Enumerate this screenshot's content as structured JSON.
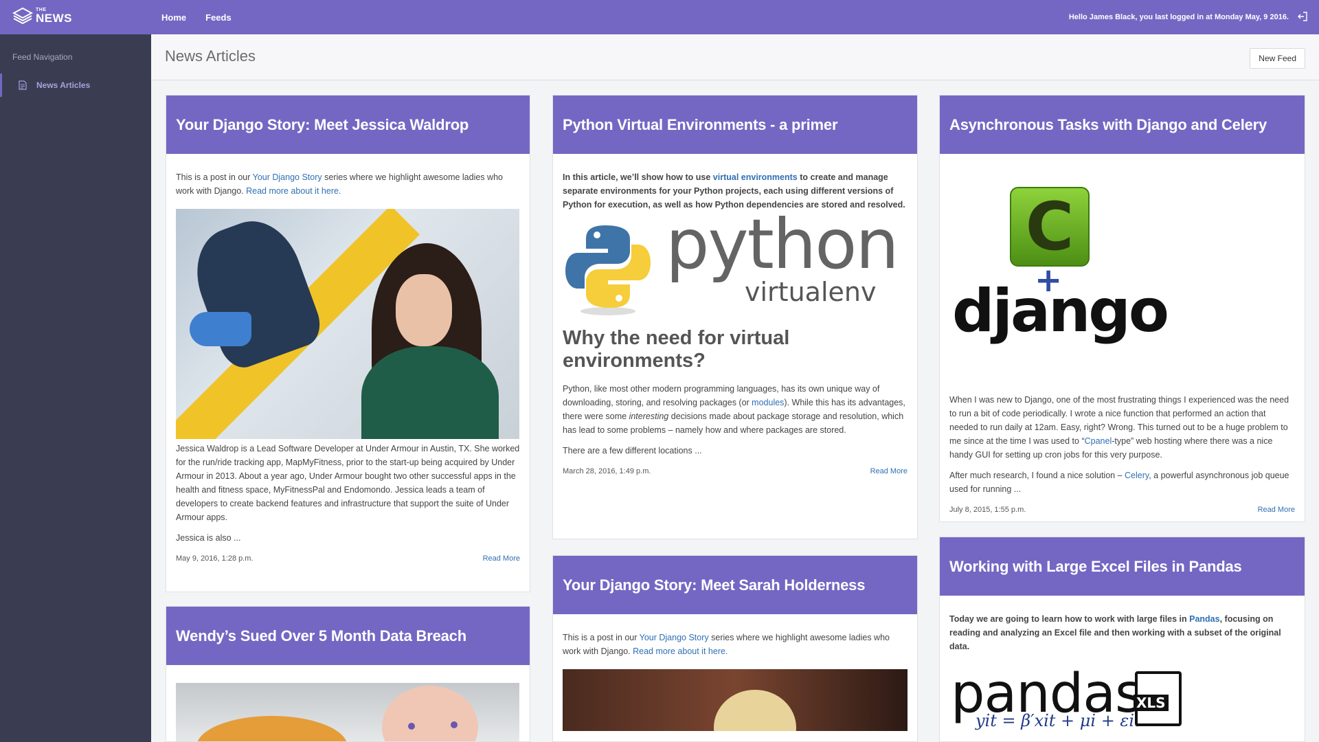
{
  "app": {
    "logo_the": "THE",
    "logo_news": "NEWS",
    "nav": [
      "Home",
      "Feeds"
    ],
    "greeting": "Hello James Black, you last logged in at Monday May, 9 2016."
  },
  "sidebar": {
    "heading": "Feed Navigation",
    "items": [
      {
        "label": "News Articles",
        "icon": "file-icon"
      }
    ]
  },
  "page": {
    "title": "News Articles",
    "new_feed_label": "New Feed"
  },
  "colors": {
    "accent": "#7467c3",
    "sidebar_bg": "#3a3d52",
    "link": "#2f6fb3"
  },
  "articles": {
    "jessica": {
      "title": "Your Django Story: Meet Jessica Waldrop",
      "intro_pre": "This is a post in our ",
      "intro_link": "Your Django Story",
      "intro_mid": " series where we highlight awesome ladies who work with Django. ",
      "intro_link2": "Read more about it here.",
      "body": "Jessica Waldrop is a Lead Software Developer at Under Armour in Austin, TX. She worked for the run/ride tracking app, MapMyFitness, prior to the start-up being acquired by Under Armour in 2013. About a year ago, Under Armour bought two other successful apps in the health and fitness space, MyFitnessPal and Endomondo. Jessica leads a team of developers to create backend features and infrastructure that support the suite of Under Armour apps.",
      "teaser": "Jessica is also ...",
      "date": "May 9, 2016, 1:28 p.m.",
      "read_more": "Read More"
    },
    "wendy": {
      "title": "Wendy’s Sued Over 5 Month Data Breach"
    },
    "python": {
      "title": "Python Virtual Environments - a primer",
      "intro_pre": "In this article, we’ll show how to use ",
      "intro_link": "virtual environments",
      "intro_post": " to create and manage separate environments for your Python projects, each using different versions of Python for execution, as well as how Python dependencies are stored and resolved.",
      "logo_main": "python",
      "logo_sub": "virtualenv",
      "subhead": "Why the need for virtual environments?",
      "body_pre": "Python, like most other modern programming languages, has its own unique way of downloading, storing, and resolving packages (or ",
      "body_link": "modules",
      "body_mid": "). While this has its advantages, there were some ",
      "body_em": "interesting",
      "body_post": " decisions made about package storage and resolution, which has lead to some problems – namely how and where packages are stored.",
      "teaser": "There are a few different locations ...",
      "date": "March 28, 2016, 1:49 p.m.",
      "read_more": "Read More"
    },
    "sarah": {
      "title": "Your Django Story: Meet Sarah Holderness",
      "intro_pre": "This is a post in our ",
      "intro_link": "Your Django Story",
      "intro_mid": " series where we highlight awesome ladies who work with Django. ",
      "intro_link2": "Read more about it here."
    },
    "celery": {
      "title": "Asynchronous Tasks with Django and Celery",
      "logo_c": "C",
      "logo_plus": "+",
      "logo_django": "django",
      "body_pre": "When I was new to Django, one of the most frustrating things I experienced was the need to run a bit of code periodically. I wrote a nice function that performed an action that needed to run daily at 12am. Easy, right? Wrong. This turned out to be a huge problem to me since at the time I was used to “",
      "body_link": "Cpanel",
      "body_post": "-type” web hosting where there was a nice handy GUI for setting up cron jobs for this very purpose.",
      "teaser_pre": "After much research, I found a nice solution – ",
      "teaser_link": "Celery",
      "teaser_post": ", a powerful asynchronous job queue used for running ...",
      "date": "July 8, 2015, 1:55 p.m.",
      "read_more": "Read More"
    },
    "pandas": {
      "title": "Working with Large Excel Files in Pandas",
      "intro_pre": "Today we are going to learn how to work with large files in ",
      "intro_link": "Pandas",
      "intro_post": ", focusing on reading and analyzing an Excel file and then working with a subset of the original data.",
      "logo_text": "pandas",
      "logo_xls": "XLS",
      "formula": "yit = β′xit + μi + εit"
    }
  }
}
